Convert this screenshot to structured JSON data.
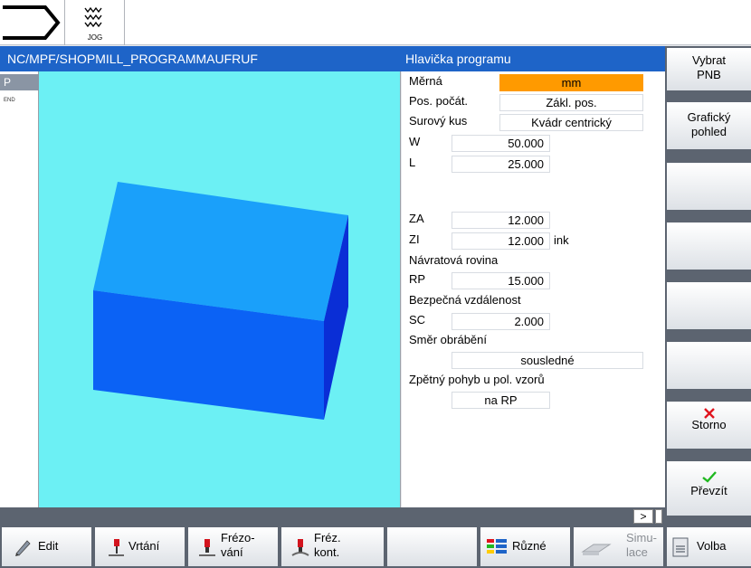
{
  "header": {
    "jog_label": "JOG",
    "program_path": "NC/MPF/SHOPMILL_PROGRAMMAUFRUF",
    "panel_title": "Hlavička programu"
  },
  "block_list": {
    "selected": "P",
    "end": "END"
  },
  "form": {
    "unit": {
      "label": "Měrná",
      "value": "mm"
    },
    "zero_offset": {
      "label": "Pos. počát.",
      "value": "Zákl. pos."
    },
    "blank": {
      "label": "Surový kus",
      "value": "Kvádr centrický"
    },
    "w": {
      "label": "W",
      "value": "50.000"
    },
    "l": {
      "label": "L",
      "value": "25.000"
    },
    "za": {
      "label": "ZA",
      "value": "12.000"
    },
    "zi": {
      "label": "ZI",
      "value": "12.000",
      "unit": "ink"
    },
    "retract_plane_heading": "Návratová rovina",
    "rp": {
      "label": "RP",
      "value": "15.000"
    },
    "safety_clearance_heading": "Bezpečná vzdálenost",
    "sc": {
      "label": "SC",
      "value": "2.000"
    },
    "machining_dir_heading": "Směr obrábění",
    "machining_dir_value": "sousledné",
    "retract_pattern_heading": "Zpětný pohyb u pol. vzorů",
    "retract_pattern_value": "na RP",
    "highlight_color": "#ff9a00"
  },
  "status": {
    "more": ">"
  },
  "vertical_softkeys": {
    "select_zero": [
      "Vybrat",
      "PNB"
    ],
    "graphic_view": [
      "Grafický",
      "pohled"
    ],
    "cancel": "Storno",
    "accept": "Převzít"
  },
  "horizontal_softkeys": {
    "edit": "Edit",
    "drilling": "Vrtání",
    "milling": [
      "Frézo-",
      "vání"
    ],
    "contour_milling": [
      "Fréz.",
      "kont."
    ],
    "misc": "Různé",
    "simulation": [
      "Simu-",
      "lace"
    ],
    "select": "Volba"
  },
  "colors": {
    "title_bar": "#1e64c8",
    "graphic_bg": "#6cf0f4",
    "block_top": "#1aa0fa",
    "block_front": "#0b62f5",
    "block_side": "#0a2ed6",
    "cancel_icon": "#e0141e",
    "accept_icon": "#1fb81f"
  },
  "icons": {
    "mode": "arrow-right-icon",
    "jog": "jog-wave-icon",
    "edit": "pencil-icon",
    "drilling": "drill-icon",
    "milling": "mill-icon",
    "contour_milling": "contour-mill-icon",
    "misc": "colored-bars-icon",
    "simulation": "simulation-icon",
    "select": "nc-file-icon",
    "cancel": "cross-icon",
    "accept": "check-icon"
  }
}
